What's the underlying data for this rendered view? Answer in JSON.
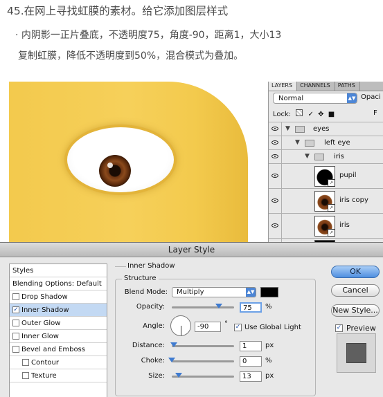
{
  "tutorial": {
    "title": "45.在网上寻找虹膜的素材。给它添加图层样式",
    "line1": "· 内阴影一正片叠底，不透明度75，角度-90，距离1，大小13",
    "line2": "复制虹膜，降低不透明度到50%，混合模式为叠加。"
  },
  "layers_panel": {
    "tabs": [
      "LAYERS",
      "CHANNELS",
      "PATHS"
    ],
    "blend_mode": "Normal",
    "opacity_label": "Opaci",
    "lock_label": "Lock:",
    "fill_label": "F",
    "layers": [
      {
        "name": "eyes",
        "type": "group"
      },
      {
        "name": "left eye",
        "type": "group"
      },
      {
        "name": "iris",
        "type": "group"
      },
      {
        "name": "pupil",
        "type": "layer"
      },
      {
        "name": "iris copy",
        "type": "layer"
      },
      {
        "name": "iris",
        "type": "layer"
      }
    ]
  },
  "dialog": {
    "title": "Layer Style",
    "styles_list": [
      {
        "label": "Styles",
        "checkbox": false,
        "checked": false,
        "selected": false
      },
      {
        "label": "Blending Options: Default",
        "checkbox": false,
        "checked": false,
        "selected": false
      },
      {
        "label": "Drop Shadow",
        "checkbox": true,
        "checked": false,
        "selected": false
      },
      {
        "label": "Inner Shadow",
        "checkbox": true,
        "checked": true,
        "selected": true
      },
      {
        "label": "Outer Glow",
        "checkbox": true,
        "checked": false,
        "selected": false
      },
      {
        "label": "Inner Glow",
        "checkbox": true,
        "checked": false,
        "selected": false
      },
      {
        "label": "Bevel and Emboss",
        "checkbox": true,
        "checked": false,
        "selected": false
      },
      {
        "label": "Contour",
        "checkbox": true,
        "checked": false,
        "selected": false
      },
      {
        "label": "Texture",
        "checkbox": true,
        "checked": false,
        "selected": false
      }
    ],
    "section_title": "Inner Shadow",
    "group_title": "Structure",
    "blend_mode_label": "Blend Mode:",
    "blend_mode_value": "Multiply",
    "shadow_color": "#000000",
    "opacity_label": "Opacity:",
    "opacity_value": "75",
    "opacity_unit": "%",
    "opacity_fraction": 0.75,
    "angle_label": "Angle:",
    "angle_value": "-90",
    "angle_unit": "°",
    "use_global_light": "Use Global Light",
    "distance_label": "Distance:",
    "distance_value": "1",
    "distance_unit": "px",
    "choke_label": "Choke:",
    "choke_value": "0",
    "choke_unit": "%",
    "size_label": "Size:",
    "size_value": "13",
    "size_unit": "px",
    "ok_label": "OK",
    "cancel_label": "Cancel",
    "new_style_label": "New Style...",
    "preview_label": "Preview"
  }
}
